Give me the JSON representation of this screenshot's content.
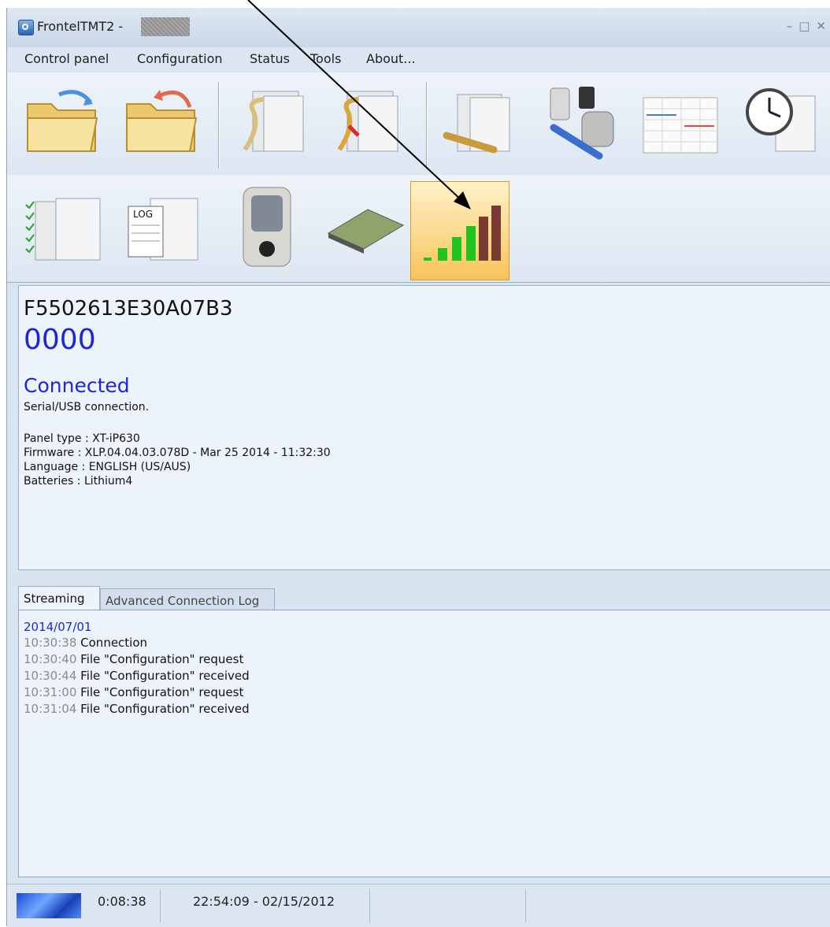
{
  "window": {
    "title": "FrontelTMT2 -"
  },
  "menu": [
    "Control panel",
    "Configuration",
    "Status",
    "Tools",
    "About..."
  ],
  "toolbar": {
    "row1": [
      "open-folder-icon",
      "restore-folder-icon",
      "connect-panel-icon",
      "disconnect-panel-icon",
      "panel-settings-icon",
      "devices-tools-icon",
      "schedule-calendar-icon",
      "panel-clock-icon"
    ],
    "row2": [
      "panel-checklist-icon",
      "panel-log-icon",
      "motion-camera-icon",
      "switch-icon",
      "signal-strength-icon"
    ],
    "active": "signal-strength-icon"
  },
  "info": {
    "serial": "F5502613E30A07B3",
    "code": "0000",
    "status": "Connected",
    "connection": "Serial/USB connection.",
    "panel_type": "Panel type : XT-iP630",
    "firmware": "Firmware : XLP.04.04.03.078D - Mar 25 2014 - 11:32:30",
    "language": "Language : ENGLISH (US/AUS)",
    "batteries": "Batteries : Lithium4"
  },
  "tabs": [
    "Streaming",
    "Advanced Connection Log"
  ],
  "log": {
    "date": "2014/07/01",
    "lines": [
      {
        "time": "10:30:38",
        "text": "Connection"
      },
      {
        "time": "10:30:40",
        "text": "File \"Configuration\" request"
      },
      {
        "time": "10:30:44",
        "text": "File \"Configuration\" received"
      },
      {
        "time": "10:31:00",
        "text": "File \"Configuration\" request"
      },
      {
        "time": "10:31:04",
        "text": "File \"Configuration\" received"
      }
    ]
  },
  "statusbar": {
    "elapsed": "0:08:38",
    "datetime": "22:54:09 - 02/15/2012"
  },
  "colors": {
    "accent_blue": "#1c26d6",
    "active_button": "#f7c45a",
    "signal_green": "#22c31f",
    "signal_brown": "#7a3b33"
  }
}
